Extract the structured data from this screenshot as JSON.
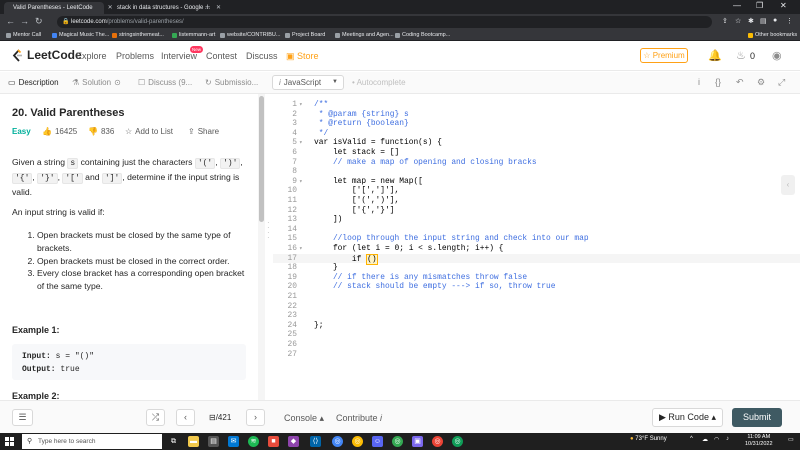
{
  "browser": {
    "tabs": [
      {
        "title": "Valid Parentheses - LeetCode",
        "active": true
      },
      {
        "title": "stack in data structures - Google ...",
        "active": false
      }
    ],
    "url": {
      "host": "leetcode.com",
      "path": "/problems/valid-parentheses/"
    },
    "bookmarks": [
      "Mentor Call",
      "Magical Music The...",
      "stringsinthemeat...",
      "listemmann-art",
      "website/CONTRIBU...",
      "Project Board",
      "Meetings and Agen...",
      "Coding Bootcamp..."
    ],
    "other_bookmarks": "Other bookmarks"
  },
  "site_nav": {
    "logo": "LeetCode",
    "links": [
      "Explore",
      "Problems",
      "Interview",
      "Contest",
      "Discuss",
      "Store"
    ],
    "new_badge": "New",
    "premium": "Premium",
    "notifications": "0"
  },
  "panel_tabs": {
    "description": "Description",
    "solution": "Solution",
    "discuss": "Discuss (9...",
    "submissions": "Submissio..."
  },
  "editor_bar": {
    "language": "JavaScript",
    "autocomplete": "Autocomplete"
  },
  "problem": {
    "title": "20. Valid Parentheses",
    "difficulty": "Easy",
    "likes": "16425",
    "dislikes": "836",
    "add_to_list": "Add to List",
    "share": "Share",
    "desc_p1_a": "Given a string",
    "desc_p1_s": "s",
    "desc_p1_b": "containing just the characters",
    "chars": [
      "'('",
      "')'",
      "'{'",
      "'}'",
      "'['"
    ],
    "and": "and",
    "last_char": "']'",
    "desc_p1_c": ", determine if the input string is valid.",
    "desc_p2": "An input string is valid if:",
    "rules": [
      "Open brackets must be closed by the same type of brackets.",
      "Open brackets must be closed in the correct order.",
      "Every close bracket has a corresponding open bracket of the same type."
    ],
    "example1_title": "Example 1:",
    "example1_input_label": "Input:",
    "example1_input": "s = \"()\"",
    "example1_output_label": "Output:",
    "example1_output": "true",
    "example2_title": "Example 2:"
  },
  "code_lines": [
    {
      "n": "1",
      "fold": true,
      "text": "/**",
      "cls": "t-c"
    },
    {
      "n": "2",
      "text": " * @param {string} s",
      "cls": "t-c"
    },
    {
      "n": "3",
      "text": " * @return {boolean}",
      "cls": "t-c"
    },
    {
      "n": "4",
      "text": " */",
      "cls": "t-c"
    },
    {
      "n": "5",
      "fold": true,
      "text": "var isValid = function(s) {"
    },
    {
      "n": "6",
      "text": "    let stack = []"
    },
    {
      "n": "7",
      "text": "    // make a map of opening and closing bracks",
      "cls": "t-c"
    },
    {
      "n": "8",
      "text": ""
    },
    {
      "n": "9",
      "fold": true,
      "text": "    let map = new Map(["
    },
    {
      "n": "10",
      "text": "        ['[',']'],"
    },
    {
      "n": "11",
      "text": "        ['(',')'],"
    },
    {
      "n": "12",
      "text": "        ['{','}']"
    },
    {
      "n": "13",
      "text": "    ])"
    },
    {
      "n": "14",
      "text": ""
    },
    {
      "n": "15",
      "text": "    //loop through the input string and check into our map",
      "cls": "t-c"
    },
    {
      "n": "16",
      "fold": true,
      "text": "    for (let i = 0; i < s.length; i++) {"
    },
    {
      "n": "17",
      "text": "        if ",
      "cursor": "()",
      "current": true
    },
    {
      "n": "18",
      "text": "    }"
    },
    {
      "n": "19",
      "text": "    // if there is any mismatches throw false",
      "cls": "t-c"
    },
    {
      "n": "20",
      "text": "    // stack should be empty ---> if so, throw true",
      "cls": "t-c"
    },
    {
      "n": "21",
      "text": ""
    },
    {
      "n": "22",
      "text": ""
    },
    {
      "n": "23",
      "text": ""
    },
    {
      "n": "24",
      "text": "};"
    },
    {
      "n": "25",
      "text": ""
    },
    {
      "n": "26",
      "text": ""
    },
    {
      "n": "27",
      "text": ""
    }
  ],
  "bottom_bar": {
    "page": "/421",
    "console": "Console",
    "contribute": "Contribute",
    "run": "Run Code",
    "submit": "Submit"
  },
  "taskbar": {
    "search_placeholder": "Type here to search",
    "weather": "73°F  Sunny",
    "time": "11:09 AM",
    "date": "10/31/2022"
  },
  "colors": {
    "brand_orange": "#ffa116",
    "easy_green": "#00af9b",
    "submit_bg": "#3f5a63",
    "comment_blue": "#3e6ee0"
  }
}
